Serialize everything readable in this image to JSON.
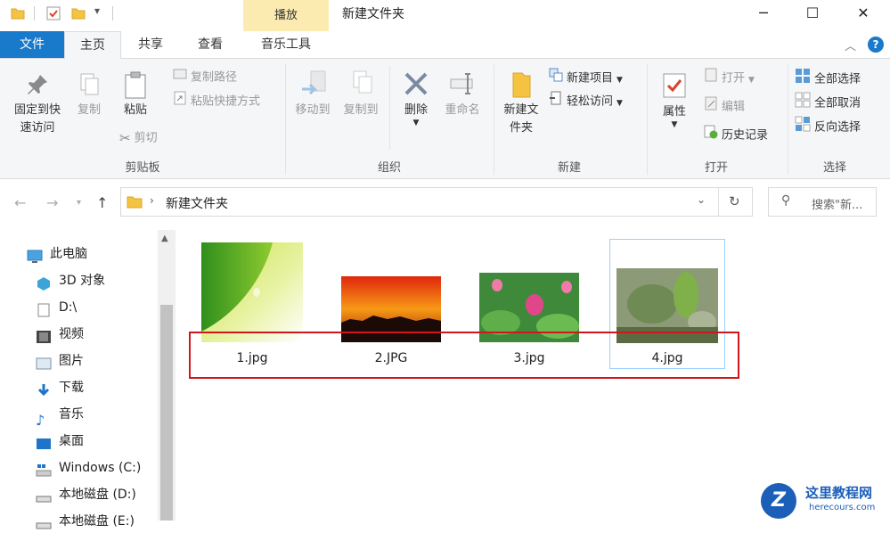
{
  "window": {
    "title": "新建文件夹",
    "context_tab": "播放",
    "controls": {
      "minimize": "─",
      "maximize": "☐",
      "close": "✕"
    }
  },
  "ribbon_tabs": {
    "file": "文件",
    "home": "主页",
    "share": "共享",
    "view": "查看",
    "music_tools": "音乐工具"
  },
  "ribbon": {
    "clipboard": {
      "label": "剪贴板",
      "pin": "固定到快速访问",
      "copy": "复制",
      "paste": "粘贴",
      "copy_path": "复制路径",
      "paste_shortcut": "粘贴快捷方式",
      "cut": "剪切"
    },
    "organize": {
      "label": "组织",
      "move_to": "移动到",
      "copy_to": "复制到",
      "delete": "删除",
      "rename": "重命名"
    },
    "new": {
      "label": "新建",
      "new_folder": "新建文件夹",
      "new_item": "新建项目",
      "easy_access": "轻松访问"
    },
    "open": {
      "label": "打开",
      "properties": "属性",
      "open": "打开",
      "edit": "编辑",
      "history": "历史记录"
    },
    "select": {
      "label": "选择",
      "select_all": "全部选择",
      "select_none": "全部取消",
      "invert": "反向选择"
    }
  },
  "address": {
    "path": "新建文件夹",
    "search_placeholder": "搜索\"新..."
  },
  "nav_tree": [
    {
      "label": "此电脑",
      "icon": "computer-icon"
    },
    {
      "label": "3D 对象",
      "icon": "3d-objects-icon"
    },
    {
      "label": "D:\\",
      "icon": "document-icon"
    },
    {
      "label": "视频",
      "icon": "video-icon"
    },
    {
      "label": "图片",
      "icon": "pictures-icon"
    },
    {
      "label": "下载",
      "icon": "download-icon"
    },
    {
      "label": "音乐",
      "icon": "music-icon"
    },
    {
      "label": "桌面",
      "icon": "desktop-icon"
    },
    {
      "label": "Windows (C:)",
      "icon": "windows-drive-icon"
    },
    {
      "label": "本地磁盘 (D:)",
      "icon": "drive-icon"
    },
    {
      "label": "本地磁盘 (E:)",
      "icon": "drive-icon"
    }
  ],
  "files": [
    {
      "name": "1.jpg",
      "selected": false
    },
    {
      "name": "2.JPG",
      "selected": false
    },
    {
      "name": "3.jpg",
      "selected": false
    },
    {
      "name": "4.jpg",
      "selected": true
    }
  ],
  "watermark": {
    "title": "这里教程网",
    "url": "herecours.com"
  },
  "colors": {
    "accent": "#1979ca",
    "context_tab": "#fcebb0",
    "highlight_box": "#d0161d"
  }
}
